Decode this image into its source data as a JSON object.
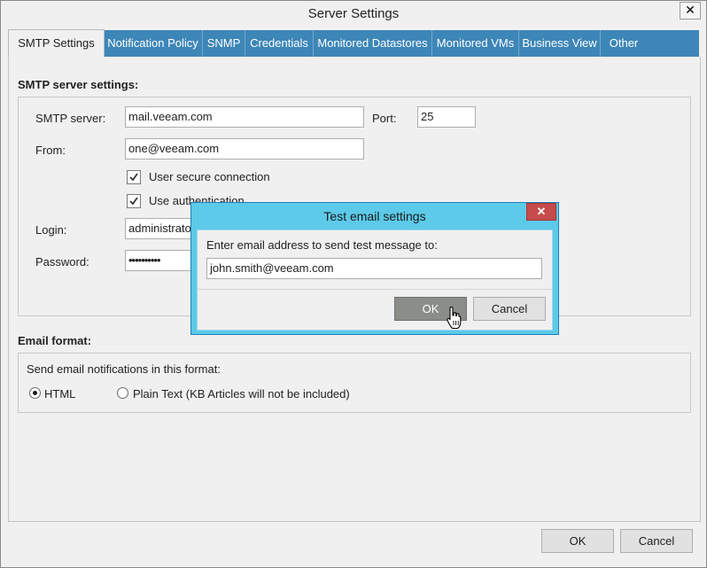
{
  "window": {
    "title": "Server Settings",
    "close_glyph": "✕"
  },
  "tabs": [
    {
      "label": "SMTP Settings",
      "active": true
    },
    {
      "label": "Notification Policy"
    },
    {
      "label": "SNMP"
    },
    {
      "label": "Credentials"
    },
    {
      "label": "Monitored Datastores"
    },
    {
      "label": "Monitored VMs"
    },
    {
      "label": "Business View"
    },
    {
      "label": "Other"
    }
  ],
  "smtp": {
    "section_label": "SMTP server settings:",
    "server_label": "SMTP server:",
    "server_value": "mail.veeam.com",
    "port_label": "Port:",
    "port_value": "25",
    "from_label": "From:",
    "from_value": "one@veeam.com",
    "secure_label": "User secure connection",
    "secure_checked": true,
    "auth_label": "Use authentication",
    "auth_checked": true,
    "login_label": "Login:",
    "login_value": "administrator",
    "password_label": "Password:",
    "password_value": "••••••••••"
  },
  "email_format": {
    "section_label": "Email format:",
    "prompt": "Send email notifications in this format:",
    "options": [
      {
        "label": "HTML",
        "selected": true
      },
      {
        "label": "Plain Text (KB Articles will not be included)",
        "selected": false
      }
    ]
  },
  "dialog_buttons": {
    "ok": "OK",
    "cancel": "Cancel"
  },
  "test_dialog": {
    "title": "Test email settings",
    "prompt": "Enter email address to send test message to:",
    "email_value": "john.smith@veeam.com",
    "ok_label": "OK",
    "cancel_label": "Cancel",
    "close_glyph": "✕"
  },
  "colors": {
    "tab_strip": "#3d86b8",
    "modal_frame": "#5ccae8",
    "modal_close": "#c64b4b"
  }
}
